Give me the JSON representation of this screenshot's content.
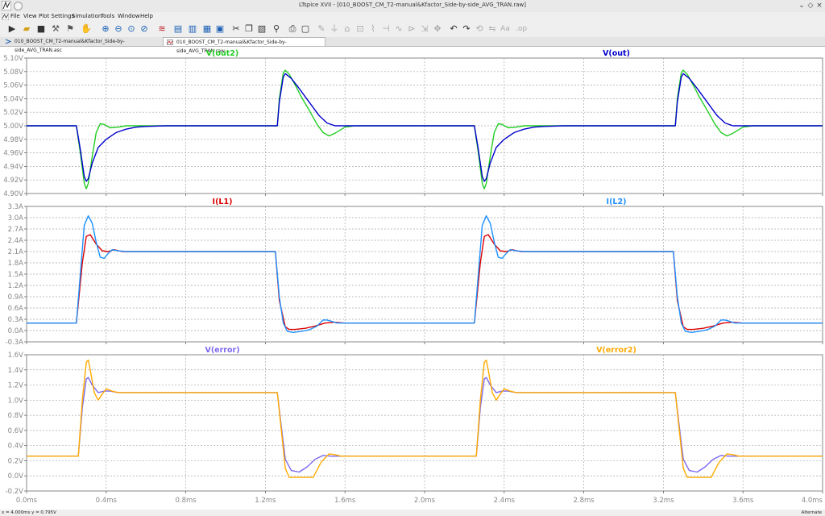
{
  "window": {
    "title": "LTspice XVII - [010_BOOST_CM_T2-manual&Kfactor_Side-by-side_AVG_TRAN.raw]"
  },
  "menu": [
    "File",
    "View",
    "Plot Settings",
    "Simulation",
    "Tools",
    "Window",
    "Help"
  ],
  "toolbar": [
    "run",
    "open",
    "save",
    "control-panel",
    "run-man",
    "hand",
    "zoom-in",
    "zoom-out",
    "zoom-fit",
    "zoom-cancel",
    "autorange",
    "tile-vertical",
    "tile-horizontal",
    "close-window",
    "cut",
    "copy",
    "paste",
    "find",
    "print",
    "print-preview",
    "wire",
    "ground",
    "label",
    "component",
    "resistor",
    "capacitor",
    "inductor",
    "diode",
    "drag",
    "move",
    "undo",
    "redo",
    "rotate",
    "mirror",
    "text",
    "spice-directive"
  ],
  "tabs": [
    {
      "label": "010_BOOST_CM_T2-manual&Kfactor_Side-by-side_AVG_TRAN.asc",
      "active": false
    },
    {
      "label": "010_BOOST_CM_T2-manual&Kfactor_Side-by-side_AVG_TRAN.raw",
      "active": true
    }
  ],
  "status": {
    "cursor": "x = 4.000ms    y = 0.795V",
    "mode": "Alternate"
  },
  "chart_data": [
    {
      "type": "line",
      "x_ticks": [
        "0.0ms",
        "0.4ms",
        "0.8ms",
        "1.2ms",
        "1.6ms",
        "2.0ms",
        "2.4ms",
        "2.8ms",
        "3.2ms",
        "3.6ms",
        "4.0ms"
      ],
      "xlim": [
        0,
        4.0
      ],
      "ylim": [
        4.9,
        5.1
      ],
      "y_ticks": [
        "5.10V",
        "5.08V",
        "5.06V",
        "5.04V",
        "5.02V",
        "5.00V",
        "4.98V",
        "4.96V",
        "4.94V",
        "4.92V",
        "4.90V"
      ],
      "series": [
        {
          "name": "V(out2)",
          "color": "#22cc22",
          "x": [
            0,
            0.25,
            0.27,
            0.29,
            0.3,
            0.31,
            0.33,
            0.35,
            0.37,
            0.39,
            0.42,
            0.46,
            0.5,
            0.55,
            0.6,
            1.26,
            1.27,
            1.29,
            1.3,
            1.32,
            1.35,
            1.38,
            1.42,
            1.46,
            1.49,
            1.52,
            1.55,
            1.6,
            1.65,
            1.7,
            2.25,
            2.27,
            2.29,
            2.3,
            2.31,
            2.33,
            2.35,
            2.37,
            2.39,
            2.42,
            2.46,
            2.5,
            2.55,
            2.6,
            3.26,
            3.27,
            3.29,
            3.3,
            3.32,
            3.35,
            3.38,
            3.42,
            3.46,
            3.49,
            3.52,
            3.55,
            3.6,
            3.65,
            4.0
          ],
          "y": [
            5.0,
            5.0,
            4.96,
            4.915,
            4.907,
            4.915,
            4.955,
            4.99,
            5.003,
            5.002,
            4.997,
            4.998,
            5.0,
            5.0,
            5.0,
            5.0,
            5.04,
            5.078,
            5.082,
            5.076,
            5.06,
            5.043,
            5.023,
            5.002,
            4.99,
            4.985,
            4.989,
            4.998,
            5.0,
            5.0,
            5.0,
            4.96,
            4.915,
            4.907,
            4.915,
            4.955,
            4.99,
            5.003,
            5.002,
            4.997,
            4.998,
            5.0,
            5.0,
            5.0,
            5.0,
            5.04,
            5.078,
            5.082,
            5.076,
            5.06,
            5.043,
            5.023,
            5.002,
            4.99,
            4.985,
            4.989,
            4.998,
            5.0,
            5.0
          ]
        },
        {
          "name": "V(out)",
          "color": "#0000cc",
          "x": [
            0,
            0.25,
            0.27,
            0.29,
            0.3,
            0.31,
            0.33,
            0.36,
            0.4,
            0.45,
            0.5,
            0.55,
            0.6,
            0.7,
            1.26,
            1.27,
            1.29,
            1.3,
            1.33,
            1.37,
            1.42,
            1.47,
            1.51,
            1.55,
            1.6,
            1.7,
            2.25,
            2.27,
            2.29,
            2.3,
            2.31,
            2.33,
            2.36,
            2.4,
            2.45,
            2.5,
            2.55,
            2.6,
            2.7,
            3.26,
            3.27,
            3.29,
            3.3,
            3.33,
            3.37,
            3.42,
            3.47,
            3.51,
            3.55,
            3.6,
            4.0
          ],
          "y": [
            5.0,
            5.0,
            4.965,
            4.925,
            4.918,
            4.922,
            4.945,
            4.968,
            4.98,
            4.99,
            4.995,
            4.998,
            4.999,
            5.0,
            5.0,
            5.035,
            5.072,
            5.077,
            5.07,
            5.055,
            5.035,
            5.015,
            5.004,
            5.0,
            5.0,
            5.0,
            5.0,
            4.965,
            4.925,
            4.918,
            4.922,
            4.945,
            4.968,
            4.98,
            4.99,
            4.995,
            4.998,
            4.999,
            5.0,
            5.0,
            5.035,
            5.072,
            5.077,
            5.07,
            5.055,
            5.035,
            5.015,
            5.004,
            5.0,
            5.0,
            5.0
          ]
        }
      ]
    },
    {
      "type": "line",
      "x_ticks": [
        "0.0ms",
        "0.4ms",
        "0.8ms",
        "1.2ms",
        "1.6ms",
        "2.0ms",
        "2.4ms",
        "2.8ms",
        "3.2ms",
        "3.6ms",
        "4.0ms"
      ],
      "xlim": [
        0,
        4.0
      ],
      "ylim": [
        -0.3,
        3.3
      ],
      "y_ticks": [
        "3.3A",
        "3.0A",
        "2.7A",
        "2.4A",
        "2.1A",
        "1.8A",
        "1.5A",
        "1.2A",
        "0.9A",
        "0.6A",
        "0.3A",
        "0.0A",
        "-0.3A"
      ],
      "series": [
        {
          "name": "I(L1)",
          "color": "#dd0000",
          "x": [
            0,
            0.25,
            0.28,
            0.3,
            0.32,
            0.35,
            0.38,
            0.41,
            0.44,
            0.48,
            0.52,
            0.6,
            1.25,
            1.27,
            1.3,
            1.32,
            1.35,
            1.4,
            1.45,
            1.5,
            1.55,
            1.6,
            2.25,
            2.28,
            2.3,
            2.32,
            2.35,
            2.38,
            2.41,
            2.44,
            2.48,
            2.52,
            2.6,
            3.25,
            3.27,
            3.3,
            3.32,
            3.35,
            3.4,
            3.45,
            3.5,
            3.55,
            3.6,
            4.0
          ],
          "y": [
            0.2,
            0.2,
            1.8,
            2.5,
            2.55,
            2.3,
            2.12,
            2.1,
            2.15,
            2.1,
            2.1,
            2.1,
            2.1,
            0.8,
            0.1,
            0.03,
            0.03,
            0.06,
            0.12,
            0.2,
            0.22,
            0.2,
            0.2,
            1.8,
            2.5,
            2.55,
            2.3,
            2.12,
            2.1,
            2.15,
            2.1,
            2.1,
            2.1,
            2.1,
            0.8,
            0.1,
            0.03,
            0.03,
            0.06,
            0.12,
            0.2,
            0.22,
            0.2,
            0.2
          ]
        },
        {
          "name": "I(L2)",
          "color": "#1e90ff",
          "x": [
            0,
            0.25,
            0.27,
            0.29,
            0.31,
            0.33,
            0.35,
            0.37,
            0.39,
            0.41,
            0.43,
            0.46,
            0.5,
            0.55,
            0.6,
            1.25,
            1.27,
            1.29,
            1.31,
            1.34,
            1.38,
            1.42,
            1.46,
            1.49,
            1.51,
            1.53,
            1.56,
            1.6,
            2.25,
            2.27,
            2.29,
            2.31,
            2.33,
            2.35,
            2.37,
            2.39,
            2.41,
            2.43,
            2.46,
            2.5,
            2.55,
            2.6,
            3.25,
            3.27,
            3.29,
            3.31,
            3.34,
            3.38,
            3.42,
            3.46,
            3.49,
            3.51,
            3.53,
            3.56,
            3.6,
            4.0
          ],
          "y": [
            0.2,
            0.2,
            1.5,
            2.8,
            3.05,
            2.85,
            2.35,
            1.95,
            1.92,
            2.05,
            2.15,
            2.12,
            2.1,
            2.1,
            2.1,
            2.1,
            0.9,
            0.2,
            -0.02,
            -0.05,
            -0.02,
            0.02,
            0.12,
            0.28,
            0.28,
            0.25,
            0.2,
            0.2,
            0.2,
            1.5,
            2.8,
            3.05,
            2.85,
            2.35,
            1.95,
            1.92,
            2.05,
            2.15,
            2.12,
            2.1,
            2.1,
            2.1,
            2.1,
            0.9,
            0.2,
            -0.02,
            -0.05,
            -0.02,
            0.02,
            0.12,
            0.28,
            0.28,
            0.25,
            0.2,
            0.2,
            0.2
          ]
        }
      ]
    },
    {
      "type": "line",
      "x_ticks": [
        "0.0ms",
        "0.4ms",
        "0.8ms",
        "1.2ms",
        "1.6ms",
        "2.0ms",
        "2.4ms",
        "2.8ms",
        "3.2ms",
        "3.6ms",
        "4.0ms"
      ],
      "xlim": [
        0,
        4.0
      ],
      "ylim": [
        -0.2,
        1.6
      ],
      "y_ticks": [
        "1.6V",
        "1.4V",
        "1.2V",
        "1.0V",
        "0.8V",
        "0.6V",
        "0.4V",
        "0.2V",
        "0.0V",
        "-0.2V"
      ],
      "series": [
        {
          "name": "V(error)",
          "color": "#7b68ee",
          "x": [
            0,
            0.26,
            0.28,
            0.3,
            0.31,
            0.33,
            0.36,
            0.39,
            0.42,
            0.46,
            0.5,
            0.6,
            1.26,
            1.28,
            1.3,
            1.33,
            1.37,
            1.41,
            1.45,
            1.49,
            1.53,
            1.57,
            1.6,
            2.26,
            2.28,
            2.3,
            2.31,
            2.33,
            2.36,
            2.39,
            2.42,
            2.46,
            2.5,
            2.6,
            3.26,
            3.28,
            3.3,
            3.33,
            3.37,
            3.41,
            3.45,
            3.49,
            3.53,
            3.57,
            3.6,
            4.0
          ],
          "y": [
            0.26,
            0.26,
            0.9,
            1.28,
            1.3,
            1.2,
            1.1,
            1.12,
            1.12,
            1.1,
            1.1,
            1.1,
            1.1,
            0.65,
            0.22,
            0.07,
            0.05,
            0.12,
            0.22,
            0.27,
            0.26,
            0.26,
            0.26,
            0.26,
            0.9,
            1.28,
            1.3,
            1.2,
            1.1,
            1.12,
            1.12,
            1.1,
            1.1,
            1.1,
            1.1,
            0.65,
            0.22,
            0.07,
            0.05,
            0.12,
            0.22,
            0.27,
            0.26,
            0.26,
            0.26,
            0.26
          ]
        },
        {
          "name": "V(error2)",
          "color": "#ffaa00",
          "x": [
            0,
            0.26,
            0.28,
            0.3,
            0.31,
            0.32,
            0.34,
            0.36,
            0.38,
            0.4,
            0.43,
            0.46,
            0.5,
            0.6,
            1.26,
            1.28,
            1.3,
            1.32,
            1.36,
            1.44,
            1.48,
            1.52,
            1.55,
            1.58,
            1.6,
            2.26,
            2.28,
            2.3,
            2.31,
            2.32,
            2.34,
            2.36,
            2.38,
            2.4,
            2.43,
            2.46,
            2.5,
            2.6,
            3.26,
            3.28,
            3.3,
            3.32,
            3.36,
            3.44,
            3.48,
            3.52,
            3.55,
            3.58,
            3.6,
            4.0
          ],
          "y": [
            0.26,
            0.26,
            1.0,
            1.5,
            1.53,
            1.4,
            1.1,
            1.0,
            1.08,
            1.15,
            1.12,
            1.1,
            1.1,
            1.1,
            1.1,
            0.6,
            0.1,
            -0.02,
            -0.02,
            -0.02,
            0.18,
            0.29,
            0.28,
            0.26,
            0.26,
            0.26,
            1.0,
            1.5,
            1.53,
            1.4,
            1.1,
            1.0,
            1.08,
            1.15,
            1.12,
            1.1,
            1.1,
            1.1,
            1.1,
            0.6,
            0.1,
            -0.02,
            -0.02,
            -0.02,
            0.18,
            0.29,
            0.28,
            0.26,
            0.26,
            0.26
          ]
        }
      ]
    }
  ]
}
